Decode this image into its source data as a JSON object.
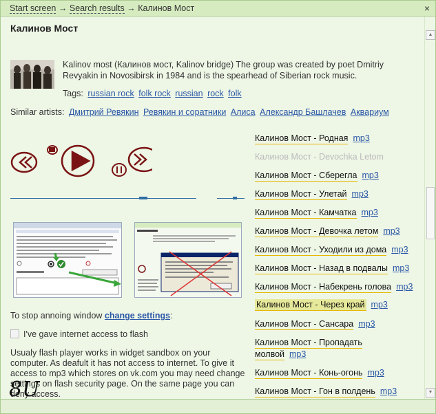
{
  "breadcrumb": {
    "start": "Start screen",
    "sep": "→",
    "results": "Search results",
    "current": "Калинов Мост"
  },
  "close_label": "×",
  "artist": {
    "name": "Калинов Мост",
    "description": "Kalinov most (Калинов мост, Kalinov bridge) The group was created by poet Dmitriy Revyakin in Novosibirsk in 1984 and is the spearhead of Siberian rock music.",
    "tags_label": "Tags:",
    "tags": [
      "russian rock",
      "folk rock",
      "russian",
      "rock",
      "folk"
    ],
    "similar_label": "Similar artists:",
    "similar": [
      "Дмитрий Ревякин",
      "Ревякин и соратники",
      "Алиса",
      "Александр Башлачев",
      "Аквариум"
    ]
  },
  "flash_help": {
    "stop_text": "To stop annoing window",
    "change_settings": "change settings",
    "colon": ":",
    "checkbox_label": "I've gave internet access to flash",
    "explanation": "Usualy flash player works in widget sandbox on your computer. As deafult it has not access to internet. To give it access to mp3 which stores on vk.com you may need change settings on flash security page. On the same page you can deny access.",
    "signature": "8U"
  },
  "mp3_label": "mp3",
  "tracks": [
    {
      "title": "Калинов Мост - Родная",
      "state": "normal"
    },
    {
      "title": "Калинов Мост - Devochka Letom",
      "state": "disabled"
    },
    {
      "title": "Калинов Мост - Сберегла",
      "state": "normal"
    },
    {
      "title": "Калинов Мост - Улетай",
      "state": "normal"
    },
    {
      "title": "Калинов Мост - Камчатка",
      "state": "normal"
    },
    {
      "title": "Калинов Мост - Девочка летом",
      "state": "normal"
    },
    {
      "title": "Калинов Мост - Уходили из дома",
      "state": "normal"
    },
    {
      "title": "Калинов Мост - Назад в подвалы",
      "state": "normal"
    },
    {
      "title": "Калинов Мост - Набекрень голова",
      "state": "normal"
    },
    {
      "title": "Калинов Мост - Через край",
      "state": "active"
    },
    {
      "title": "Калинов Мост - Сансара",
      "state": "normal"
    },
    {
      "title": "Калинов Мост - Пропадать",
      "title2": "молвой",
      "state": "normal"
    },
    {
      "title": "Калинов Мост - Конь-огонь",
      "state": "normal"
    },
    {
      "title": "Калинов Мост - Гон в полдень",
      "state": "normal"
    }
  ],
  "colors": {
    "accent": "#2a58a6",
    "topbar": "#d6ecc0",
    "background": "#eef6e6",
    "track_underline": "#e6b800",
    "player_ink": "#7a1414",
    "arrow": "#3aa63a"
  }
}
